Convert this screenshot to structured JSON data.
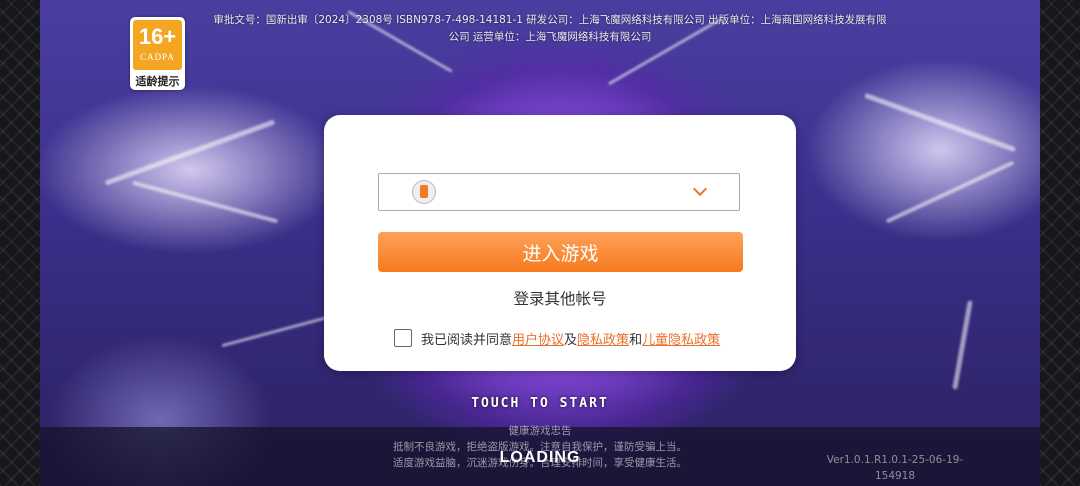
{
  "age_rating": {
    "label": "16+",
    "org": "CADPA",
    "tip": "适龄提示"
  },
  "license_text": {
    "line1": "审批文号：国新出审〔2024〕2308号 ISBN978-7-498-14181-1 研发公司：上海飞魔网络科技有限公司 出版单位：上海商国网络科技发展有限",
    "line2": "公司 运营单位：上海飞魔网络科技有限公司"
  },
  "login": {
    "account_icon": "phone-icon",
    "dropdown_icon": "chevron-down-icon",
    "enter_button": "进入游戏",
    "other_account": "登录其他帐号",
    "agreement": {
      "prefix": "我已阅读并同意",
      "user_agreement": "用户协议",
      "and1": "及",
      "privacy_policy": "隐私政策",
      "and2": "和",
      "child_privacy": "儿童隐私政策",
      "checked": false
    }
  },
  "touch_to_start": "TOUCH TO START",
  "health_notice": {
    "title": "健康游戏忠告",
    "line1": "抵制不良游戏，拒绝盗版游戏。注意自我保护，谨防受骗上当。",
    "line2": "适度游戏益脑，沉迷游戏伤身。合理安排时间，享受健康生活。"
  },
  "loading_text": "LOADING",
  "version": "Ver1.0.1.R1.0.1-25-06-19-154918",
  "colors": {
    "accent": "#f57a1e",
    "link": "#e8702a",
    "badge": "#f4a622"
  }
}
